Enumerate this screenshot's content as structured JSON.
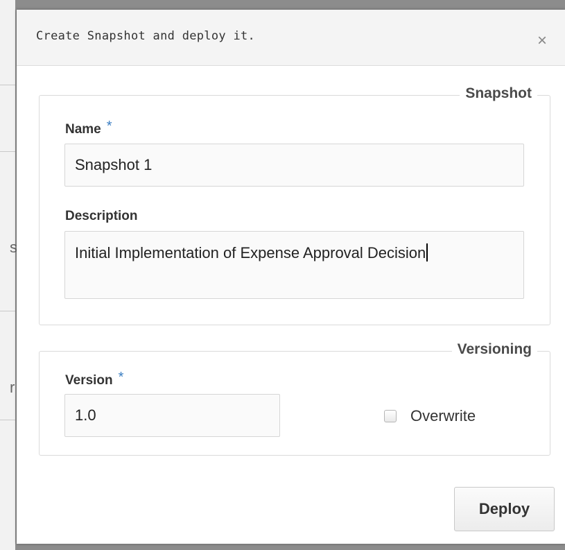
{
  "background": {
    "fragments": [
      "s",
      "r"
    ]
  },
  "dialog": {
    "title": "Create Snapshot and deploy it.",
    "close_icon": "close-icon",
    "close_glyph": "×"
  },
  "snapshot_section": {
    "legend": "Snapshot",
    "name_label": "Name",
    "name_required": "*",
    "name_value": "Snapshot 1",
    "description_label": "Description",
    "description_value": "Initial Implementation of Expense Approval Decision"
  },
  "versioning_section": {
    "legend": "Versioning",
    "version_label": "Version",
    "version_required": "*",
    "version_value": "1.0",
    "overwrite_label": "Overwrite",
    "overwrite_checked": false
  },
  "footer": {
    "deploy_label": "Deploy"
  },
  "colors": {
    "required_star": "#3b7ec2",
    "header_bg": "#f4f4f4",
    "backdrop": "#8c8c8c"
  }
}
